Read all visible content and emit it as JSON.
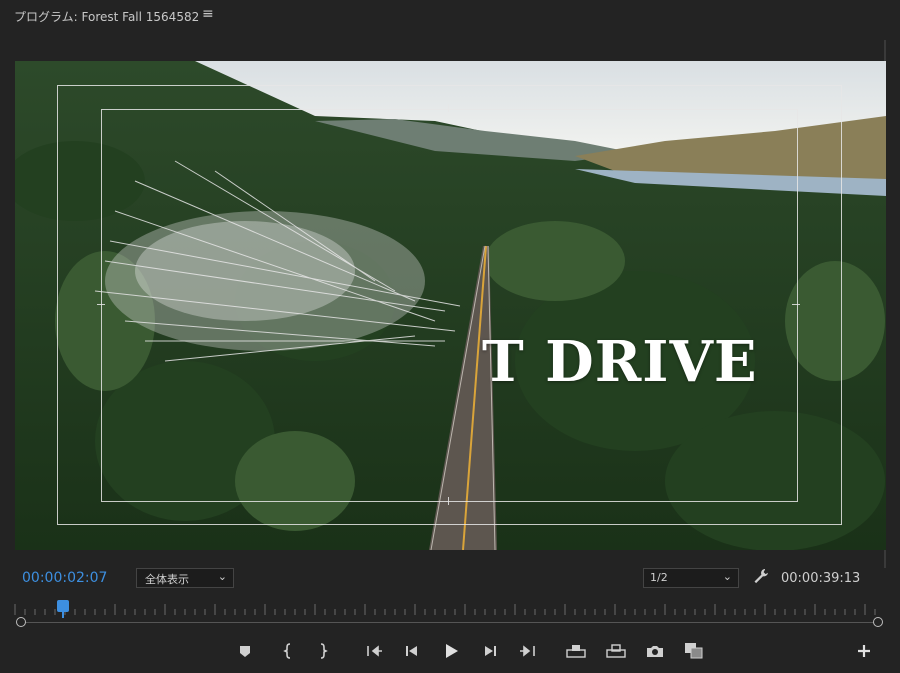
{
  "panel": {
    "title": "プログラム: Forest Fall 1564582",
    "menu_icon": "hamburger-menu-icon"
  },
  "viewer": {
    "overlay_text": "T DRIVE"
  },
  "controls": {
    "current_timecode": "00:00:02:07",
    "zoom_value": "全体表示",
    "resolution_value": "1/2",
    "duration_timecode": "00:00:39:13",
    "settings_icon": "wrench-icon"
  },
  "transport": {
    "buttons": [
      "add-marker-icon",
      "mark-in-icon",
      "mark-out-icon",
      "go-to-in-icon",
      "step-back-icon",
      "play-icon",
      "step-forward-icon",
      "go-to-out-icon",
      "lift-icon",
      "extract-icon",
      "export-frame-icon",
      "comparison-view-icon",
      "add-button-icon"
    ]
  },
  "colors": {
    "accent": "#3d8fe0",
    "background": "#232323"
  }
}
